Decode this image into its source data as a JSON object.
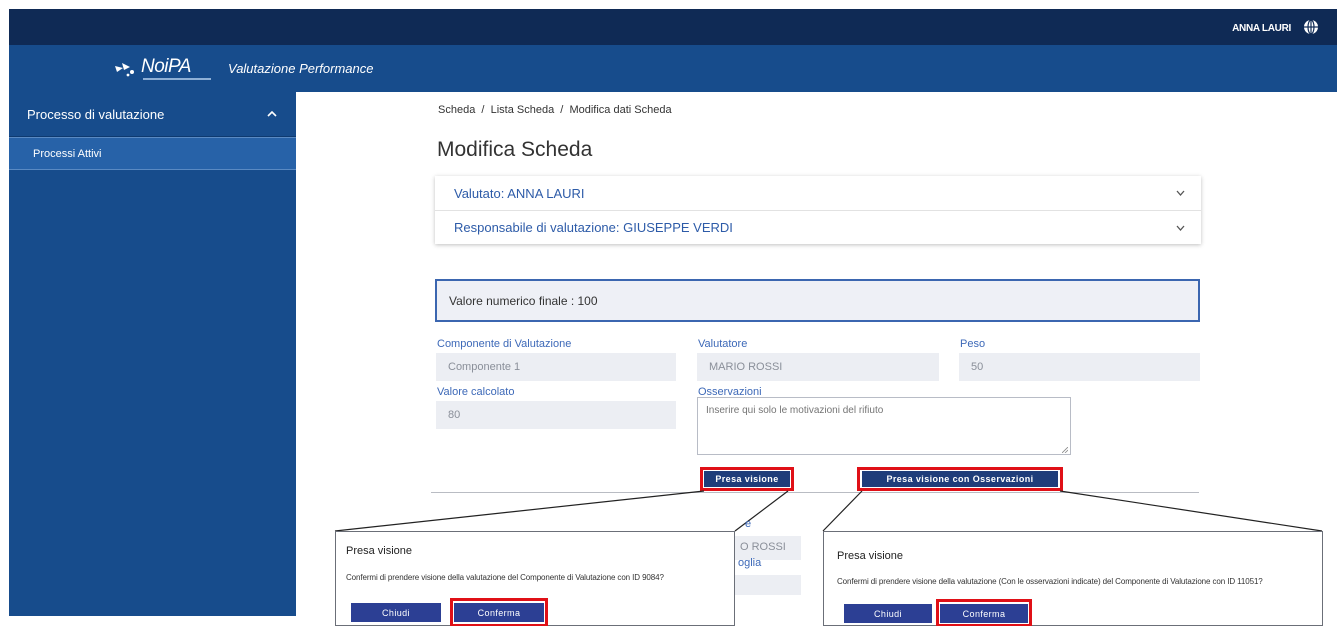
{
  "topbar": {
    "user": "ANNA LAURI"
  },
  "brand": {
    "logo_text": "NoiPA",
    "app_title": "Valutazione Performance"
  },
  "sidebar": {
    "section_title": "Processo di valutazione",
    "items": [
      {
        "label": "Processi Attivi"
      }
    ]
  },
  "page": {
    "breadcrumb": "Scheda  /  Lista Scheda  /  Modifica dati Scheda",
    "title": "Modifica Scheda"
  },
  "accordion": [
    {
      "label": "Valutato: ANNA LAURI"
    },
    {
      "label": "Responsabile di valutazione: GIUSEPPE VERDI"
    }
  ],
  "final_value": "Valore numerico finale : 100",
  "form": {
    "componente_label": "Componente di Valutazione",
    "componente_value": "Componente 1",
    "valutatore_label": "Valutatore",
    "valutatore_value": "MARIO ROSSI",
    "peso_label": "Peso",
    "peso_value": "50",
    "valore_label": "Valore calcolato",
    "valore_value": "80",
    "osservazioni_label": "Osservazioni",
    "osservazioni_placeholder": "Inserire qui solo le motivazioni del rifiuto"
  },
  "buttons": {
    "presa_visione": "Presa visione",
    "presa_visione_oss": "Presa visione con Osservazioni"
  },
  "behind_text": {
    "rossi": "O ROSSI",
    "oglia": "oglia",
    "e": "e"
  },
  "popup_left": {
    "title": "Presa visione",
    "text": "Confermi di prendere visione della valutazione del Componente di Valutazione con ID 9084?",
    "close": "Chiudi",
    "confirm": "Conferma"
  },
  "popup_right": {
    "title": "Presa visione",
    "text": "Confermi di prendere visione della valutazione (Con le osservazioni indicate) del Componente di Valutazione con ID 11051?",
    "close": "Chiudi",
    "confirm": "Conferma"
  },
  "colors": {
    "topbar": "#0f2a55",
    "brand": "#174c8c",
    "accent": "#3d69b8",
    "button": "#1f3d7a",
    "highlight": "#e01017"
  }
}
